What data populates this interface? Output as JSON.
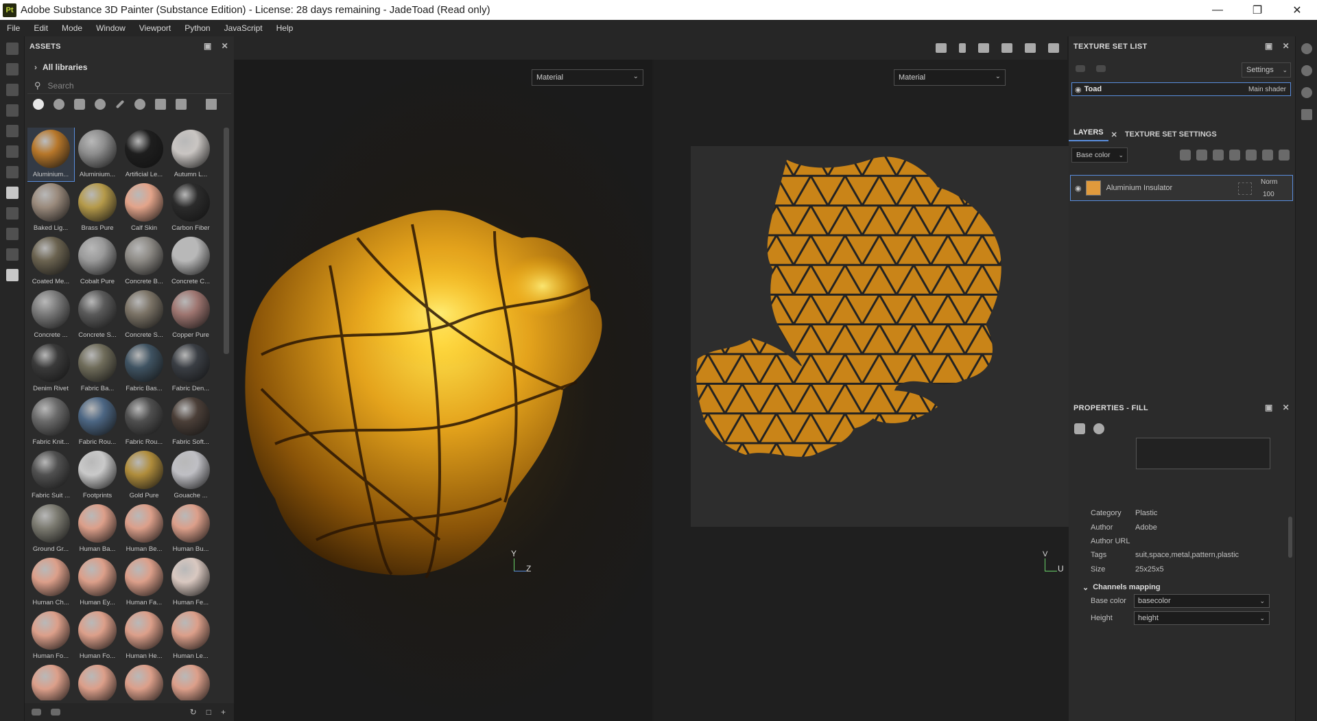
{
  "window": {
    "title": "Adobe Substance 3D Painter (Substance Edition) - License: 28 days remaining - JadeToad (Read only)",
    "app_icon_text": "Pt",
    "controls": [
      "minimize",
      "restore",
      "close"
    ]
  },
  "menu": [
    "File",
    "Edit",
    "Mode",
    "Window",
    "Viewport",
    "Python",
    "JavaScript",
    "Help"
  ],
  "assets": {
    "title": "ASSETS",
    "breadcrumb": "All libraries",
    "search_placeholder": "Search",
    "filter_icons": [
      "materials-icon",
      "smart-materials-icon",
      "masks-icon",
      "smart-masks-icon",
      "brushes-icon",
      "textures-icon",
      "patterns-icon",
      "environment-icon",
      "grid-view-icon"
    ],
    "items": [
      {
        "label": "Aluminium...",
        "color": "#b7772a",
        "selected": true
      },
      {
        "label": "Aluminium...",
        "color": "#8e8e8e"
      },
      {
        "label": "Artificial Le...",
        "color": "#1e1e1e"
      },
      {
        "label": "Autumn L...",
        "color": "#c9c5c2"
      },
      {
        "label": "Baked Lig...",
        "color": "#9a8a7c"
      },
      {
        "label": "Brass Pure",
        "color": "#b59a4a"
      },
      {
        "label": "Calf Skin",
        "color": "#e3a48a"
      },
      {
        "label": "Carbon Fiber",
        "color": "#2b2b2b"
      },
      {
        "label": "Coated Me...",
        "color": "#6b6350"
      },
      {
        "label": "Cobalt Pure",
        "color": "#9a9a9a"
      },
      {
        "label": "Concrete B...",
        "color": "#8d8a85"
      },
      {
        "label": "Concrete C...",
        "color": "#b8b8b8"
      },
      {
        "label": "Concrete ...",
        "color": "#7a7a7a"
      },
      {
        "label": "Concrete S...",
        "color": "#5a5a5a"
      },
      {
        "label": "Concrete S...",
        "color": "#7b7366"
      },
      {
        "label": "Copper Pure",
        "color": "#9e7570"
      },
      {
        "label": "Denim Rivet",
        "color": "#3a3a3a"
      },
      {
        "label": "Fabric Ba...",
        "color": "#6f6c5a"
      },
      {
        "label": "Fabric Bas...",
        "color": "#3f5362"
      },
      {
        "label": "Fabric Den...",
        "color": "#3a3e44"
      },
      {
        "label": "Fabric Knit...",
        "color": "#6a6a6a"
      },
      {
        "label": "Fabric Rou...",
        "color": "#4c6683"
      },
      {
        "label": "Fabric Rou...",
        "color": "#4f4f4f"
      },
      {
        "label": "Fabric Soft...",
        "color": "#4b3f38"
      },
      {
        "label": "Fabric Suit ...",
        "color": "#505050"
      },
      {
        "label": "Footprints",
        "color": "#c9c9c9"
      },
      {
        "label": "Gold Pure",
        "color": "#b08d3c"
      },
      {
        "label": "Gouache ...",
        "color": "#bfbfc4"
      },
      {
        "label": "Ground Gr...",
        "color": "#7b7a70"
      },
      {
        "label": "Human Ba...",
        "color": "#dc9f8a"
      },
      {
        "label": "Human Be...",
        "color": "#dc9f8a"
      },
      {
        "label": "Human Bu...",
        "color": "#dc9f8a"
      },
      {
        "label": "Human Ch...",
        "color": "#dc9f8a"
      },
      {
        "label": "Human Ey...",
        "color": "#dc9f8a"
      },
      {
        "label": "Human Fa...",
        "color": "#dc9f8a"
      },
      {
        "label": "Human Fe...",
        "color": "#d9c8c0"
      },
      {
        "label": "Human Fo...",
        "color": "#dc9f8a"
      },
      {
        "label": "Human Fo...",
        "color": "#dc9f8a"
      },
      {
        "label": "Human He...",
        "color": "#dc9f8a"
      },
      {
        "label": "Human Le...",
        "color": "#dc9f8a"
      },
      {
        "label": "",
        "color": "#dc9f8a"
      },
      {
        "label": "",
        "color": "#dc9f8a"
      },
      {
        "label": "",
        "color": "#dc9f8a"
      },
      {
        "label": "",
        "color": "#dc9f8a"
      }
    ]
  },
  "viewport": {
    "left_select": "Material",
    "right_select": "Material",
    "axis_left": {
      "y": "Y",
      "z": "Z"
    },
    "axis_right": {
      "y": "V",
      "u": "U"
    },
    "accent_gold": "#e3a21c"
  },
  "texture_set_list": {
    "title": "TEXTURE SET LIST",
    "settings_label": "Settings",
    "set_name": "Toad",
    "shader": "Main shader"
  },
  "layers": {
    "tab_layers": "LAYERS",
    "tab_tss": "TEXTURE SET SETTINGS",
    "channel": "Base color",
    "layer_name": "Aluminium Insulator",
    "blend_mode": "Norm",
    "opacity": "100",
    "swatch_color": "#e09a3c"
  },
  "properties": {
    "title": "PROPERTIES - FILL",
    "category_label": "Category",
    "category": "Plastic",
    "author_label": "Author",
    "author": "Adobe",
    "author_url_label": "Author URL",
    "tags_label": "Tags",
    "tags": "suit,space,metal,pattern,plastic",
    "size_label": "Size",
    "size": "25x25x5",
    "channels_title": "Channels mapping",
    "base_color_label": "Base color",
    "base_color_value": "basecolor",
    "height_label": "Height",
    "height_value": "height"
  }
}
